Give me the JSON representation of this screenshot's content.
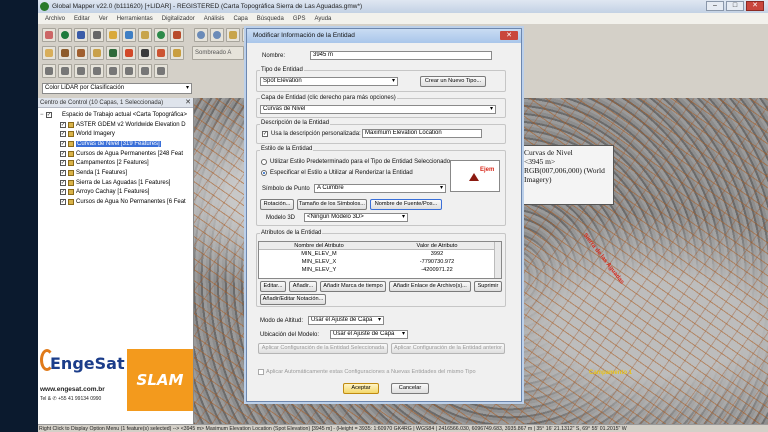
{
  "window": {
    "title": "Global Mapper v22.0 (b111620) [+LIDAR] - REGISTERED (Carta Topográfica Sierra de Las Aguadas.gmw*)",
    "controls": [
      "–",
      "□",
      "✕"
    ]
  },
  "menu": [
    "Archivo",
    "Editar",
    "Ver",
    "Herramientas",
    "Digitalizador",
    "Análisis",
    "Capa",
    "Búsqueda",
    "GPS",
    "Ayuda"
  ],
  "toolbar": {
    "shading_label": "Sombreado A",
    "lidar_combo": "Color LiDAR por Clasificación"
  },
  "control_center": {
    "title": "Centro de Control (10 Capas, 1 Seleccionada)",
    "workspace": "Espacio de Trabajo actual <Carta Topográfica>",
    "layers": [
      {
        "label": "ASTER GDEM v2 Worldwide Elevation D",
        "selected": false
      },
      {
        "label": "World Imagery",
        "selected": false
      },
      {
        "label": "Curvas de Nivel [319 Features]",
        "selected": true
      },
      {
        "label": "Cursos de Agua Permanentes [248 Feat",
        "selected": false
      },
      {
        "label": "Campamentos [2 Features]",
        "selected": false
      },
      {
        "label": "Senda [1 Features]",
        "selected": false
      },
      {
        "label": "Sierra de Las Aguadas [1 Features]",
        "selected": false
      },
      {
        "label": "Arroyo Cachay [1 Features]",
        "selected": false
      },
      {
        "label": "Cursos de Agua No Permanentes [6 Feat",
        "selected": false
      }
    ]
  },
  "map": {
    "tooltip_lines": [
      "Curvas de Nivel",
      "<3945 m>",
      "RGB(007,006,000) (World Imagery)"
    ],
    "red_label": "Sierra de las Aguadas",
    "yellow_label": "Campamento 1"
  },
  "dialog": {
    "title": "Modificar Información de la Entidad",
    "close": "✕",
    "name_label": "Nombre:",
    "name_value": "3945 m",
    "type_group": "Tipo de Entidad",
    "type_value": "Spot Elevation",
    "new_type_button": "Crear un Nuevo Tipo...",
    "layer_group": "Capa de Entidad (clic derecho para más opciones)",
    "layer_value": "Curvas de Nivel",
    "desc_group": "Descripción de la Entidad",
    "custom_desc_label": "Usa la descripción personalizada:",
    "custom_desc_value": "Maximum Elevation Location",
    "style_group": "Estilo de la Entidad",
    "radio_default": "Utilizar Estilo Predeterminado para el Tipo de Entidad Seleccionado",
    "radio_custom": "Especificar el Estilo a Utilizar al Renderizar la Entidad",
    "point_symbol_label": "Símbolo de Punto",
    "point_symbol_value": "A Cumbre",
    "rotation_button": "Rotación...",
    "symbol_size_button": "Tamaño de los Símbolos...",
    "font_name_button": "Nombre de Fuente/Pos...",
    "model3d_label": "Modelo 3D",
    "model3d_value": "<Ningún Modelo 3D>",
    "preview_text": "Ejem",
    "attr_group": "Atributos de la Entidad",
    "attr_col_name": "Nombre del Atributo",
    "attr_col_value": "Valor de Atributo",
    "attributes": [
      {
        "name": "MIN_ELEV_M",
        "value": "3992"
      },
      {
        "name": "MIN_ELEV_X",
        "value": "-7790730.972"
      },
      {
        "name": "MIN_ELEV_Y",
        "value": "-4200971.22"
      }
    ],
    "edit_button": "Editar...",
    "add_button": "Añadir...",
    "add_timestamp_button": "Añadir Marca de tiempo",
    "add_link_button": "Añadir Enlace de Archivo(s)...",
    "delete_button": "Suprimir",
    "add_edit_notes_button": "Añadir/Editar Notación...",
    "altitude_mode_label": "Modo de Altitud:",
    "altitude_mode_value": "Usar el Ajuste de Capa",
    "model_location_label": "Ubicación del Modelo:",
    "model_location_value": "Usar el Ajuste de Capa",
    "apply_config_selected": "Aplicar Configuración de la Entidad Seleccionada",
    "apply_config_previous": "Aplicar Configuración de la Entidad anterior",
    "auto_apply_label": "Aplicar Automáticamente estas Configuraciones a Nuevas Entidades del mismo Tipo",
    "ok_button": "Aceptar",
    "cancel_button": "Cancelar"
  },
  "status_bar": "Right Click to Display Option Menu (1 feature(s) selected) --> <3945 m> Maximum Elevation Location (Spot Elevation) [3945 m] - (Height = 3935: 1:60970  GK4RG | WGS84 | 2416566.030, 6096749.683, 3935.867 m | 35° 16' 21.1312\" S, 69° 55' 01.2015\" W",
  "logos": {
    "engesat_name": "EngeSat",
    "engesat_web": "www.engesat.com.br",
    "engesat_tel": "Tel & ✆ +55 41 99134 0990",
    "slam": "SLAM"
  },
  "colors": {
    "accent": "#3a6fd8",
    "title_bar": "#c9dcf3",
    "map_red_label": "#d8281a",
    "slam_orange": "#f39a1d",
    "engesat_blue": "#1b3d8a"
  }
}
